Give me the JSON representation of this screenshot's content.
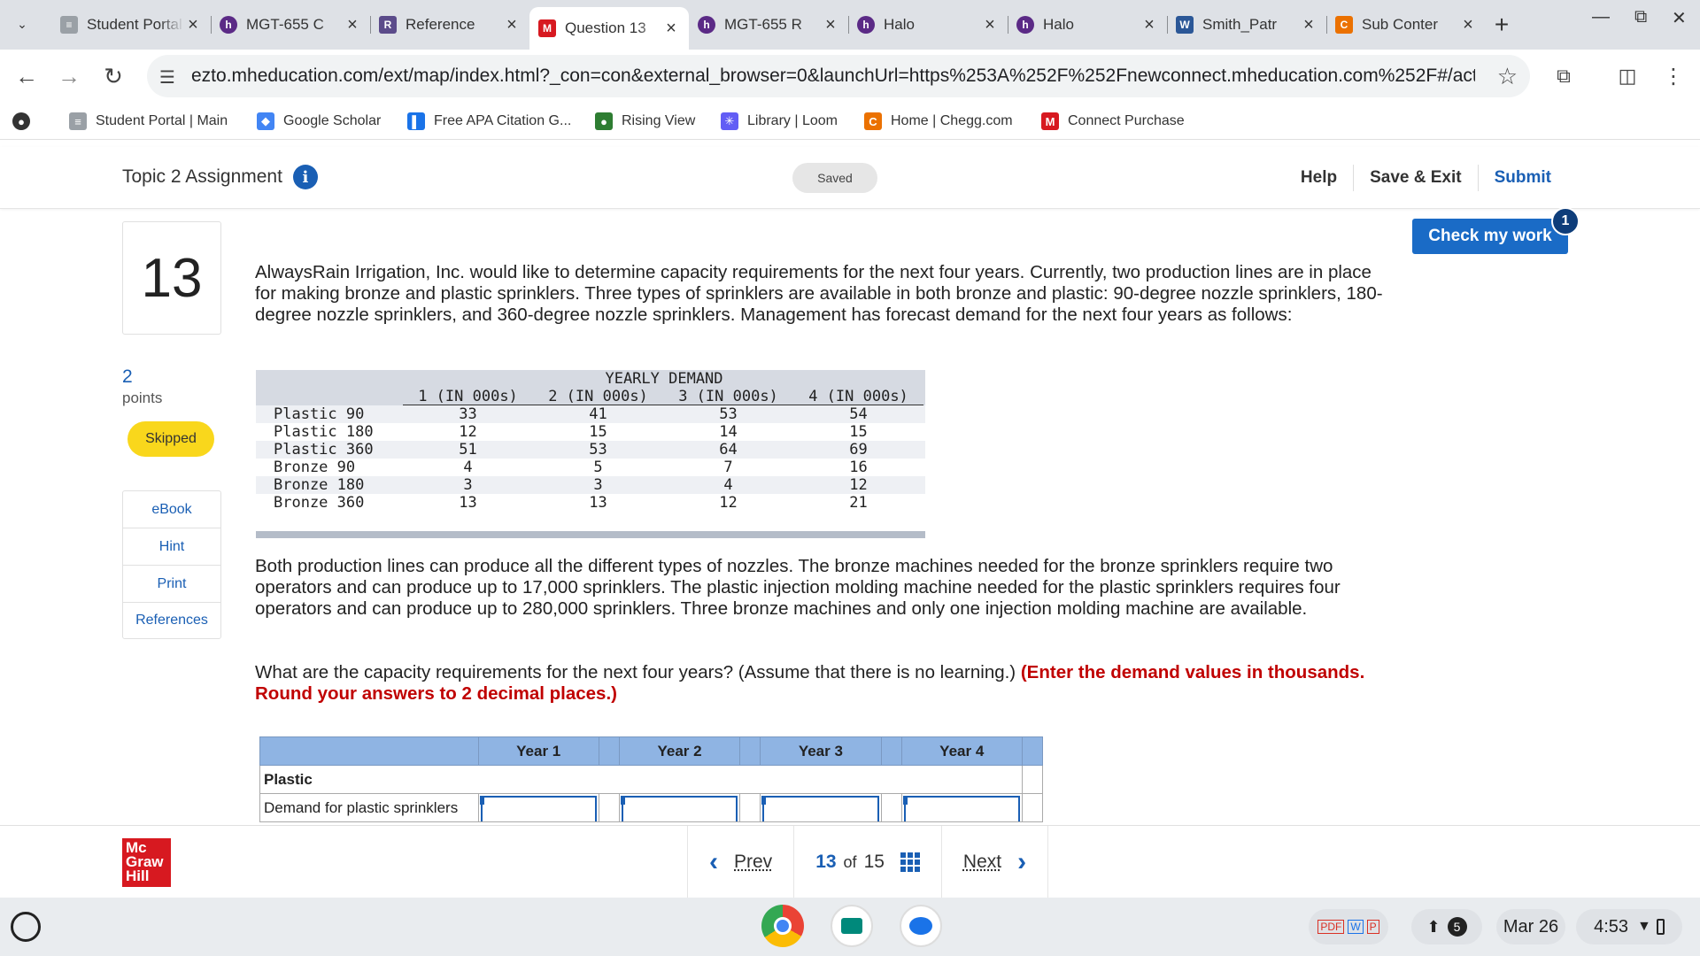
{
  "browser": {
    "tabs": [
      {
        "title": "Student Portal",
        "icon": "doc-icon",
        "color": "#9aa0a6",
        "active": false
      },
      {
        "title": "MGT-655 C",
        "icon": "halo-icon",
        "color": "#5b2a86",
        "active": false
      },
      {
        "title": "Reference",
        "icon": "reference-icon",
        "color": "#5b4b8a",
        "active": false
      },
      {
        "title": "Question 13",
        "icon": "mcgraw-icon",
        "color": "#d71920",
        "active": true
      },
      {
        "title": "MGT-655 R",
        "icon": "halo-icon",
        "color": "#5b2a86",
        "active": false
      },
      {
        "title": "Halo",
        "icon": "halo-icon",
        "color": "#5b2a86",
        "active": false
      },
      {
        "title": "Halo",
        "icon": "halo-icon",
        "color": "#5b2a86",
        "active": false
      },
      {
        "title": "Smith_Patr",
        "icon": "word-icon",
        "color": "#2b5797",
        "active": false
      },
      {
        "title": "Sub Conter",
        "icon": "chegg-icon",
        "color": "#eb7100",
        "active": false
      }
    ],
    "url": "ezto.mheducation.com/ext/map/index.html?_con=con&external_browser=0&launchUrl=https%253A%252F%252Fnewconnect.mheducation.com%252F#/activity/questio...",
    "bookmarks": [
      {
        "label": "Student Portal | Main",
        "icon": "doc-icon"
      },
      {
        "label": "Google Scholar",
        "icon": "scholar-icon"
      },
      {
        "label": "Free APA Citation G...",
        "icon": "bookmark-icon"
      },
      {
        "label": "Rising View",
        "icon": "rising-view-icon"
      },
      {
        "label": "Library | Loom",
        "icon": "loom-icon"
      },
      {
        "label": "Home | Chegg.com",
        "icon": "chegg-icon"
      },
      {
        "label": "Connect Purchase",
        "icon": "mcgraw-icon"
      }
    ]
  },
  "header": {
    "title": "Topic 2 Assignment",
    "saved": "Saved",
    "help": "Help",
    "save_exit": "Save & Exit",
    "submit": "Submit"
  },
  "question": {
    "number": "13",
    "points_value": "2",
    "points_label": "points",
    "status": "Skipped",
    "tools": [
      "eBook",
      "Hint",
      "Print",
      "References"
    ],
    "check_work": "Check my work",
    "check_badge": "1",
    "intro": "AlwaysRain Irrigation, Inc. would like to determine capacity requirements for the next four years. Currently, two production lines are in place for making bronze and plastic sprinklers. Three types of sprinklers are available in both bronze and plastic: 90-degree nozzle sprinklers, 180-degree nozzle sprinklers, and 360-degree nozzle sprinklers. Management has forecast demand for the next four years as follows:",
    "body": "Both production lines can produce all the different types of nozzles. The bronze machines needed for the bronze sprinklers require two operators and can produce up to 17,000 sprinklers. The plastic injection molding machine needed for the plastic sprinklers requires four operators and can produce up to 280,000 sprinklers. Three bronze machines and only one injection molding machine are available.",
    "prompt": "What are the capacity requirements for the next four years? (Assume that there is no learning.)",
    "instruction": "(Enter the demand values in thousands. Round your answers to 2 decimal places.)"
  },
  "demand_table": {
    "group_header": "YEARLY DEMAND",
    "columns": [
      "1 (IN 000s)",
      "2 (IN 000s)",
      "3 (IN 000s)",
      "4 (IN 000s)"
    ],
    "rows": [
      {
        "label": "Plastic 90",
        "values": [
          "33",
          "41",
          "53",
          "54"
        ]
      },
      {
        "label": "Plastic 180",
        "values": [
          "12",
          "15",
          "14",
          "15"
        ]
      },
      {
        "label": "Plastic 360",
        "values": [
          "51",
          "53",
          "64",
          "69"
        ]
      },
      {
        "label": "Bronze 90",
        "values": [
          "4",
          "5",
          "7",
          "16"
        ]
      },
      {
        "label": "Bronze 180",
        "values": [
          "3",
          "3",
          "4",
          "12"
        ]
      },
      {
        "label": "Bronze 360",
        "values": [
          "13",
          "13",
          "12",
          "21"
        ]
      }
    ]
  },
  "answer_table": {
    "columns": [
      "Year 1",
      "Year 2",
      "Year 3",
      "Year 4"
    ],
    "section": "Plastic",
    "row_label": "Demand for plastic sprinklers"
  },
  "pager": {
    "prev": "Prev",
    "current": "13",
    "of": "of",
    "total": "15",
    "next": "Next"
  },
  "brand": {
    "logo_lines": [
      "Mc",
      "Graw",
      "Hill"
    ]
  },
  "taskbar": {
    "notifications": "5",
    "date": "Mar 26",
    "time": "4:53"
  }
}
